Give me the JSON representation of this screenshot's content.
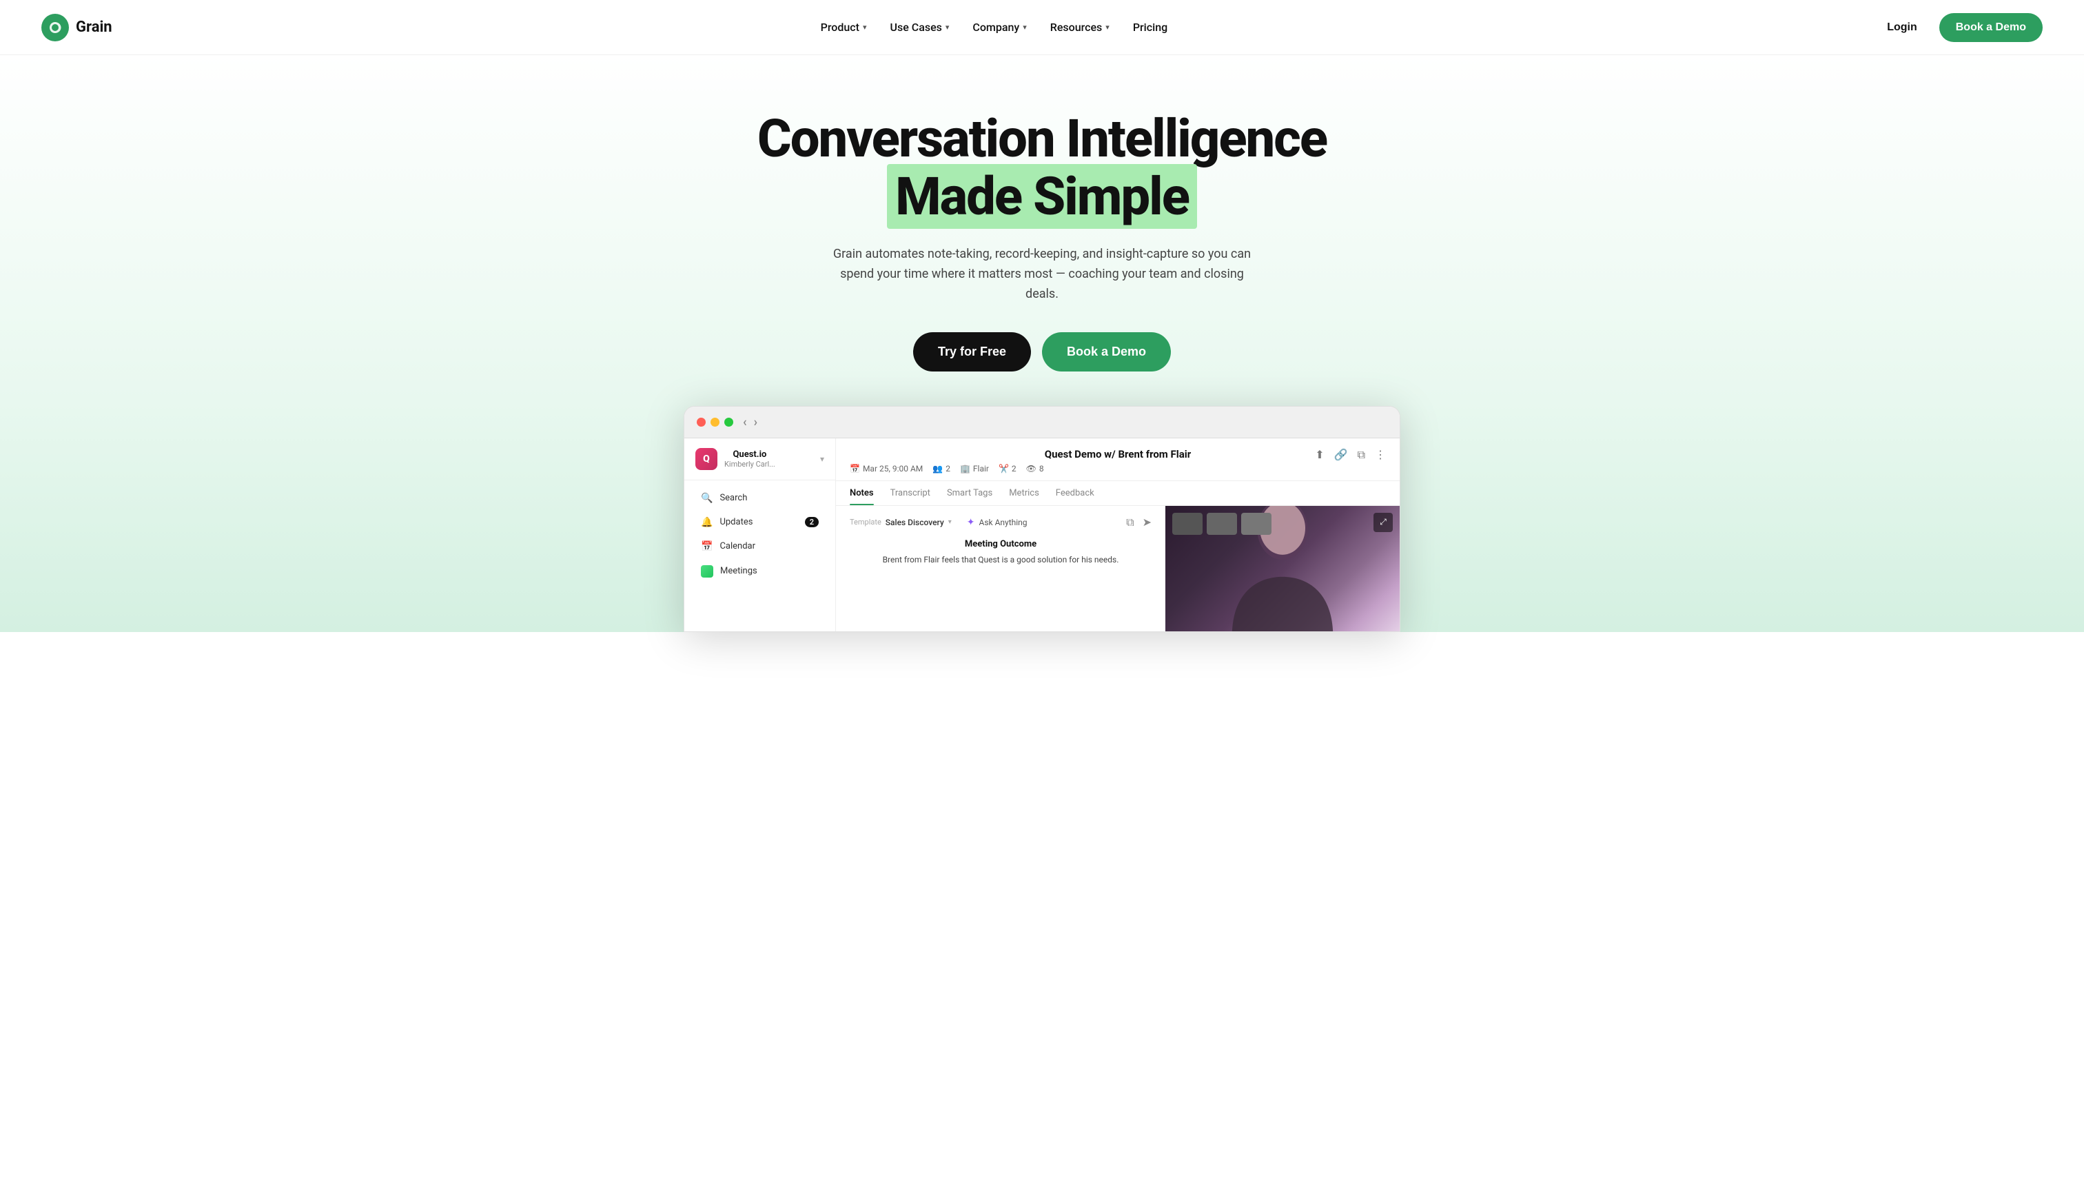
{
  "brand": {
    "name": "Grain",
    "logo_alt": "Grain logo"
  },
  "nav": {
    "links": [
      {
        "label": "Product",
        "has_chevron": true
      },
      {
        "label": "Use Cases",
        "has_chevron": true
      },
      {
        "label": "Company",
        "has_chevron": true
      },
      {
        "label": "Resources",
        "has_chevron": true
      },
      {
        "label": "Pricing",
        "has_chevron": false
      }
    ],
    "login_label": "Login",
    "book_demo_label": "Book a Demo"
  },
  "hero": {
    "title_line1": "Conversation Intelligence",
    "title_line2_plain": "",
    "title_highlight": "Made Simple",
    "subtitle": "Grain automates note-taking, record-keeping, and insight-capture so you can spend your time where it matters most — coaching your team and closing deals.",
    "cta_primary": "Try for Free",
    "cta_secondary": "Book a Demo"
  },
  "app_preview": {
    "meeting_title": "Quest Demo w/ Brent from Flair",
    "meeting_date": "Mar 25, 9:00 AM",
    "meeting_attendees": "2",
    "meeting_company": "Flair",
    "meeting_clips": "2",
    "meeting_views": "8",
    "tabs": [
      "Notes",
      "Transcript",
      "Smart Tags",
      "Metrics",
      "Feedback"
    ],
    "active_tab": "Notes",
    "template_label": "Template",
    "template_name": "Sales Discovery",
    "ask_anything_label": "Ask Anything",
    "section_title": "Meeting Outcome",
    "section_text": "Brent from Flair feels that Quest is a good solution for his needs.",
    "sidebar": {
      "org_name": "Quest.io",
      "org_user": "Kimberly Carl...",
      "nav_items": [
        {
          "label": "Search",
          "icon": "search"
        },
        {
          "label": "Updates",
          "icon": "bell",
          "badge": "2"
        },
        {
          "label": "Calendar",
          "icon": "calendar"
        },
        {
          "label": "Meetings",
          "icon": "meetings"
        }
      ]
    }
  }
}
